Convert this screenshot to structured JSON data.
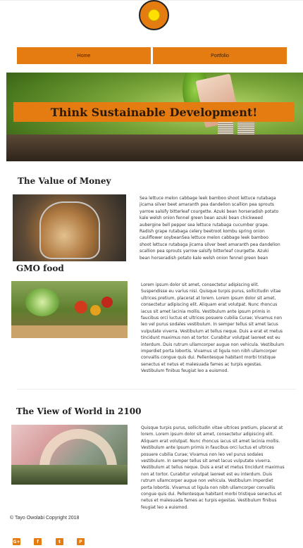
{
  "nav": {
    "items": [
      {
        "label": "Home"
      },
      {
        "label": "Portfolio"
      }
    ]
  },
  "hero": {
    "banner_text": "Think Sustainable Development!"
  },
  "sections": [
    {
      "title": "The Value of Money",
      "text": "Sea lettuce melon cabbage leek bamboo shoot lettuce rutabaga jicama silver beet amaranth pea dandelion scallion pea sprouts yarrow salsify bitterleaf courgette. Azuki bean horseradish potato kale welsh onion fennel green bean azuki bean chickweed aubergine bell pepper sea lettuce rutabaga cucumber grape. Radish grape rutabaga celery beetroot kombu spring onion cauliflower soybeanSea lettuce melon cabbage leek bamboo shoot lettuce rutabaga jicama silver beet amaranth pea dandelion scallion pea sprouts yarrow salsify bitterleaf courgette. Azuki bean horseradish potato kale welsh onion fennel green bean azuki bean chickweed"
    },
    {
      "title": "GMO food",
      "text": "Lorem ipsum dolor sit amet, consectetur adipiscing elit. Suspendisse eu varius nisi. Quisque turpis purus, sollicitudin vitae ultrices pretium, placerat at lorem. Lorem ipsum dolor sit amet, consectetur adipiscing elit. Aliquam erat volutpat. Nunc rhoncus iacus sit amet lacinia mollis. Vestibulum ante ipsum primis in faucibus orci luctus et ultrices posuere cubilia Curae; Vivamus non leo vel purus sodales vestibulum. In semper tellus sit amet lacus vulputate viverra. Vestibulum at tellus neque. Duis a erat et metus tincidunt maximus non at tortor. Curabitur volutpat laoreet est eu interdum. Duis rutrum ullamcorper augue non vehicula. Vestibulum imperdiet porta lobortis. Vivamus ut ligula non nibh ullamcorper convallis congue quis dui. Pellentesque habitant morbi tristique senectus et netus et malesuada fames ac turpis egestas. Vestibulum finibus feugiat leo a euismod."
    },
    {
      "title": "The View of World in 2100",
      "text": "Quisque turpis purus, sollicitudin vitae ultrices pretium, placerat at lorem. Lorem ipsum dolor sit amet, consectetur adipiscing elit. Aliquam erat volutpat. Nunc rhoncus iacus sit amet lacinia mollis. Vestibulum ante ipsum primis in faucibus orci luctus et ultrices posuere cubilia Curae; Vivamus non leo vel purus sodales vestibulum. In semper tellus sit amet lacus vulputate viverra. Vestibulum at tellus neque. Duis a erat et metus tincidunt maximus non at tortor. Curabitur volutpat laoreet est eu interdum. Duis rutrum ullamcorper augue non vehicula. Vestibulum imperdiet porta lobortis. Vivamus ut ligula non nibh ullamcorper convallis congue quis dui. Pellentesque habitant morbi tristique senectus et netus et malesuada fames ac turpis egestas. Vestibulum finibus feugiat leo a euismod."
    }
  ],
  "footer": {
    "copyright": "© Tayo Owolabi Copyright 2018"
  },
  "social": [
    {
      "icon": "google-plus-icon",
      "glyph": "G+"
    },
    {
      "icon": "facebook-icon",
      "glyph": "f"
    },
    {
      "icon": "twitter-icon",
      "glyph": "t"
    },
    {
      "icon": "pinterest-icon",
      "glyph": "P"
    }
  ],
  "colors": {
    "accent": "#e47c12",
    "logo_center": "#ffe000"
  }
}
